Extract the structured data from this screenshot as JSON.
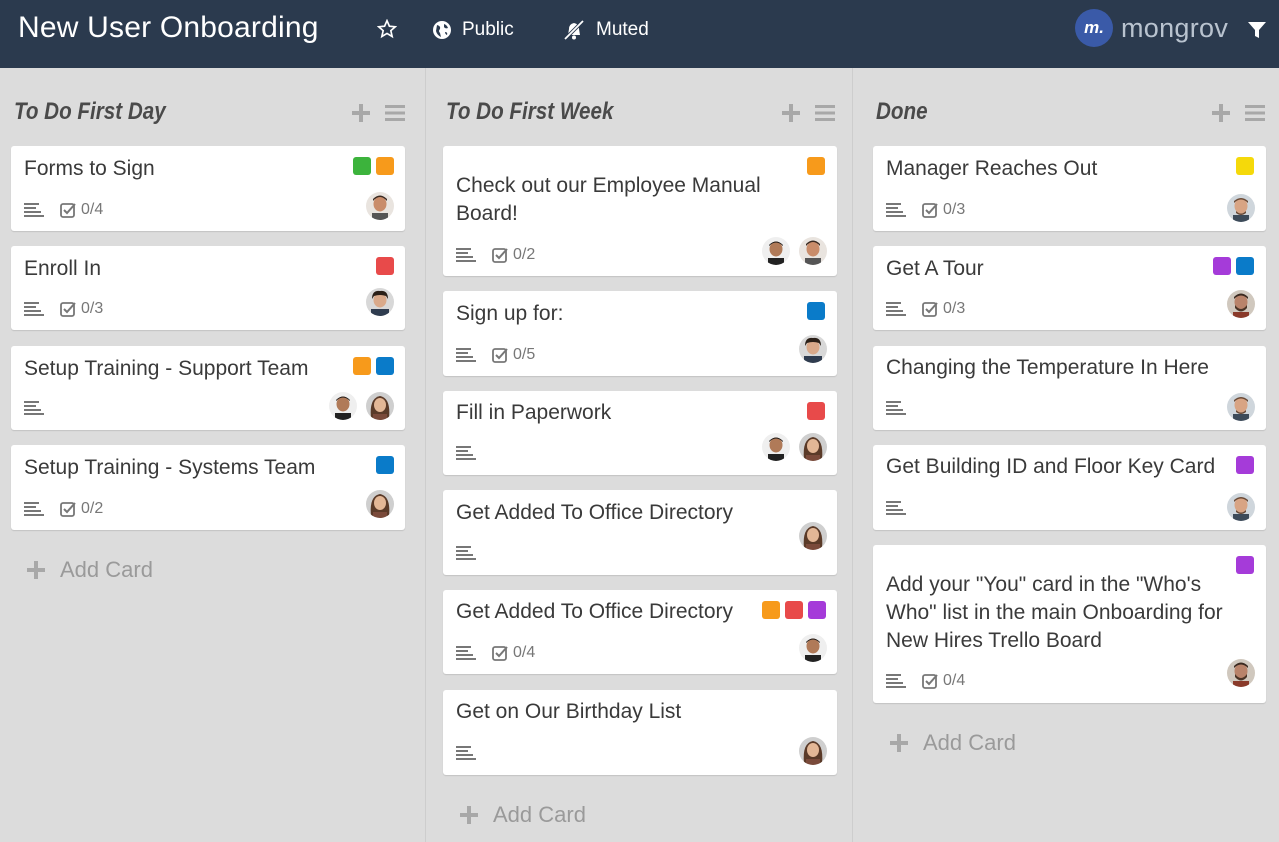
{
  "board": {
    "title": "New User Onboarding",
    "visibility": "Public",
    "notifications": "Muted"
  },
  "brand": {
    "logo_text": "mongrov",
    "logo_mark": "m."
  },
  "colors": {
    "green": "#3cb33c",
    "orange": "#f79a1b",
    "red": "#e84a4a",
    "blue": "#0a7bc9",
    "purple": "#a53bd9",
    "yellow": "#f5d90a"
  },
  "add_card_label": "Add Card",
  "columns": [
    {
      "title": "To Do First Day",
      "cards": [
        {
          "title": "Forms to Sign",
          "checklist": "0/4"
        },
        {
          "title": "Enroll In",
          "checklist": "0/3"
        },
        {
          "title": "Setup Training - Support Team",
          "checklist": ""
        },
        {
          "title": "Setup Training - Systems Team",
          "checklist": "0/2"
        }
      ]
    },
    {
      "title": "To Do First Week",
      "cards": [
        {
          "title_line1": "Check out our Employee Manual",
          "title_line2": "Board!",
          "checklist": "0/2"
        },
        {
          "title": "Sign up for:",
          "checklist": "0/5"
        },
        {
          "title": "Fill in Paperwork",
          "checklist": ""
        },
        {
          "title": "Get Added To Office Directory",
          "checklist": ""
        },
        {
          "title": "Get Added To Office Directory",
          "checklist": "0/4"
        },
        {
          "title": "Get on Our Birthday List",
          "checklist": ""
        }
      ]
    },
    {
      "title": "Done",
      "cards": [
        {
          "title": "Manager Reaches Out",
          "checklist": "0/3"
        },
        {
          "title": "Get A Tour",
          "checklist": "0/3"
        },
        {
          "title": "Changing the Temperature In Here",
          "checklist": ""
        },
        {
          "title": "Get Building ID and Floor Key Card",
          "checklist": ""
        },
        {
          "title_line1": "Add your \"You\" card in the \"Who's",
          "title_line2": "Who\" list in the main Onboarding for",
          "title_line3": "New Hires Trello Board",
          "checklist": "0/4"
        }
      ]
    }
  ]
}
